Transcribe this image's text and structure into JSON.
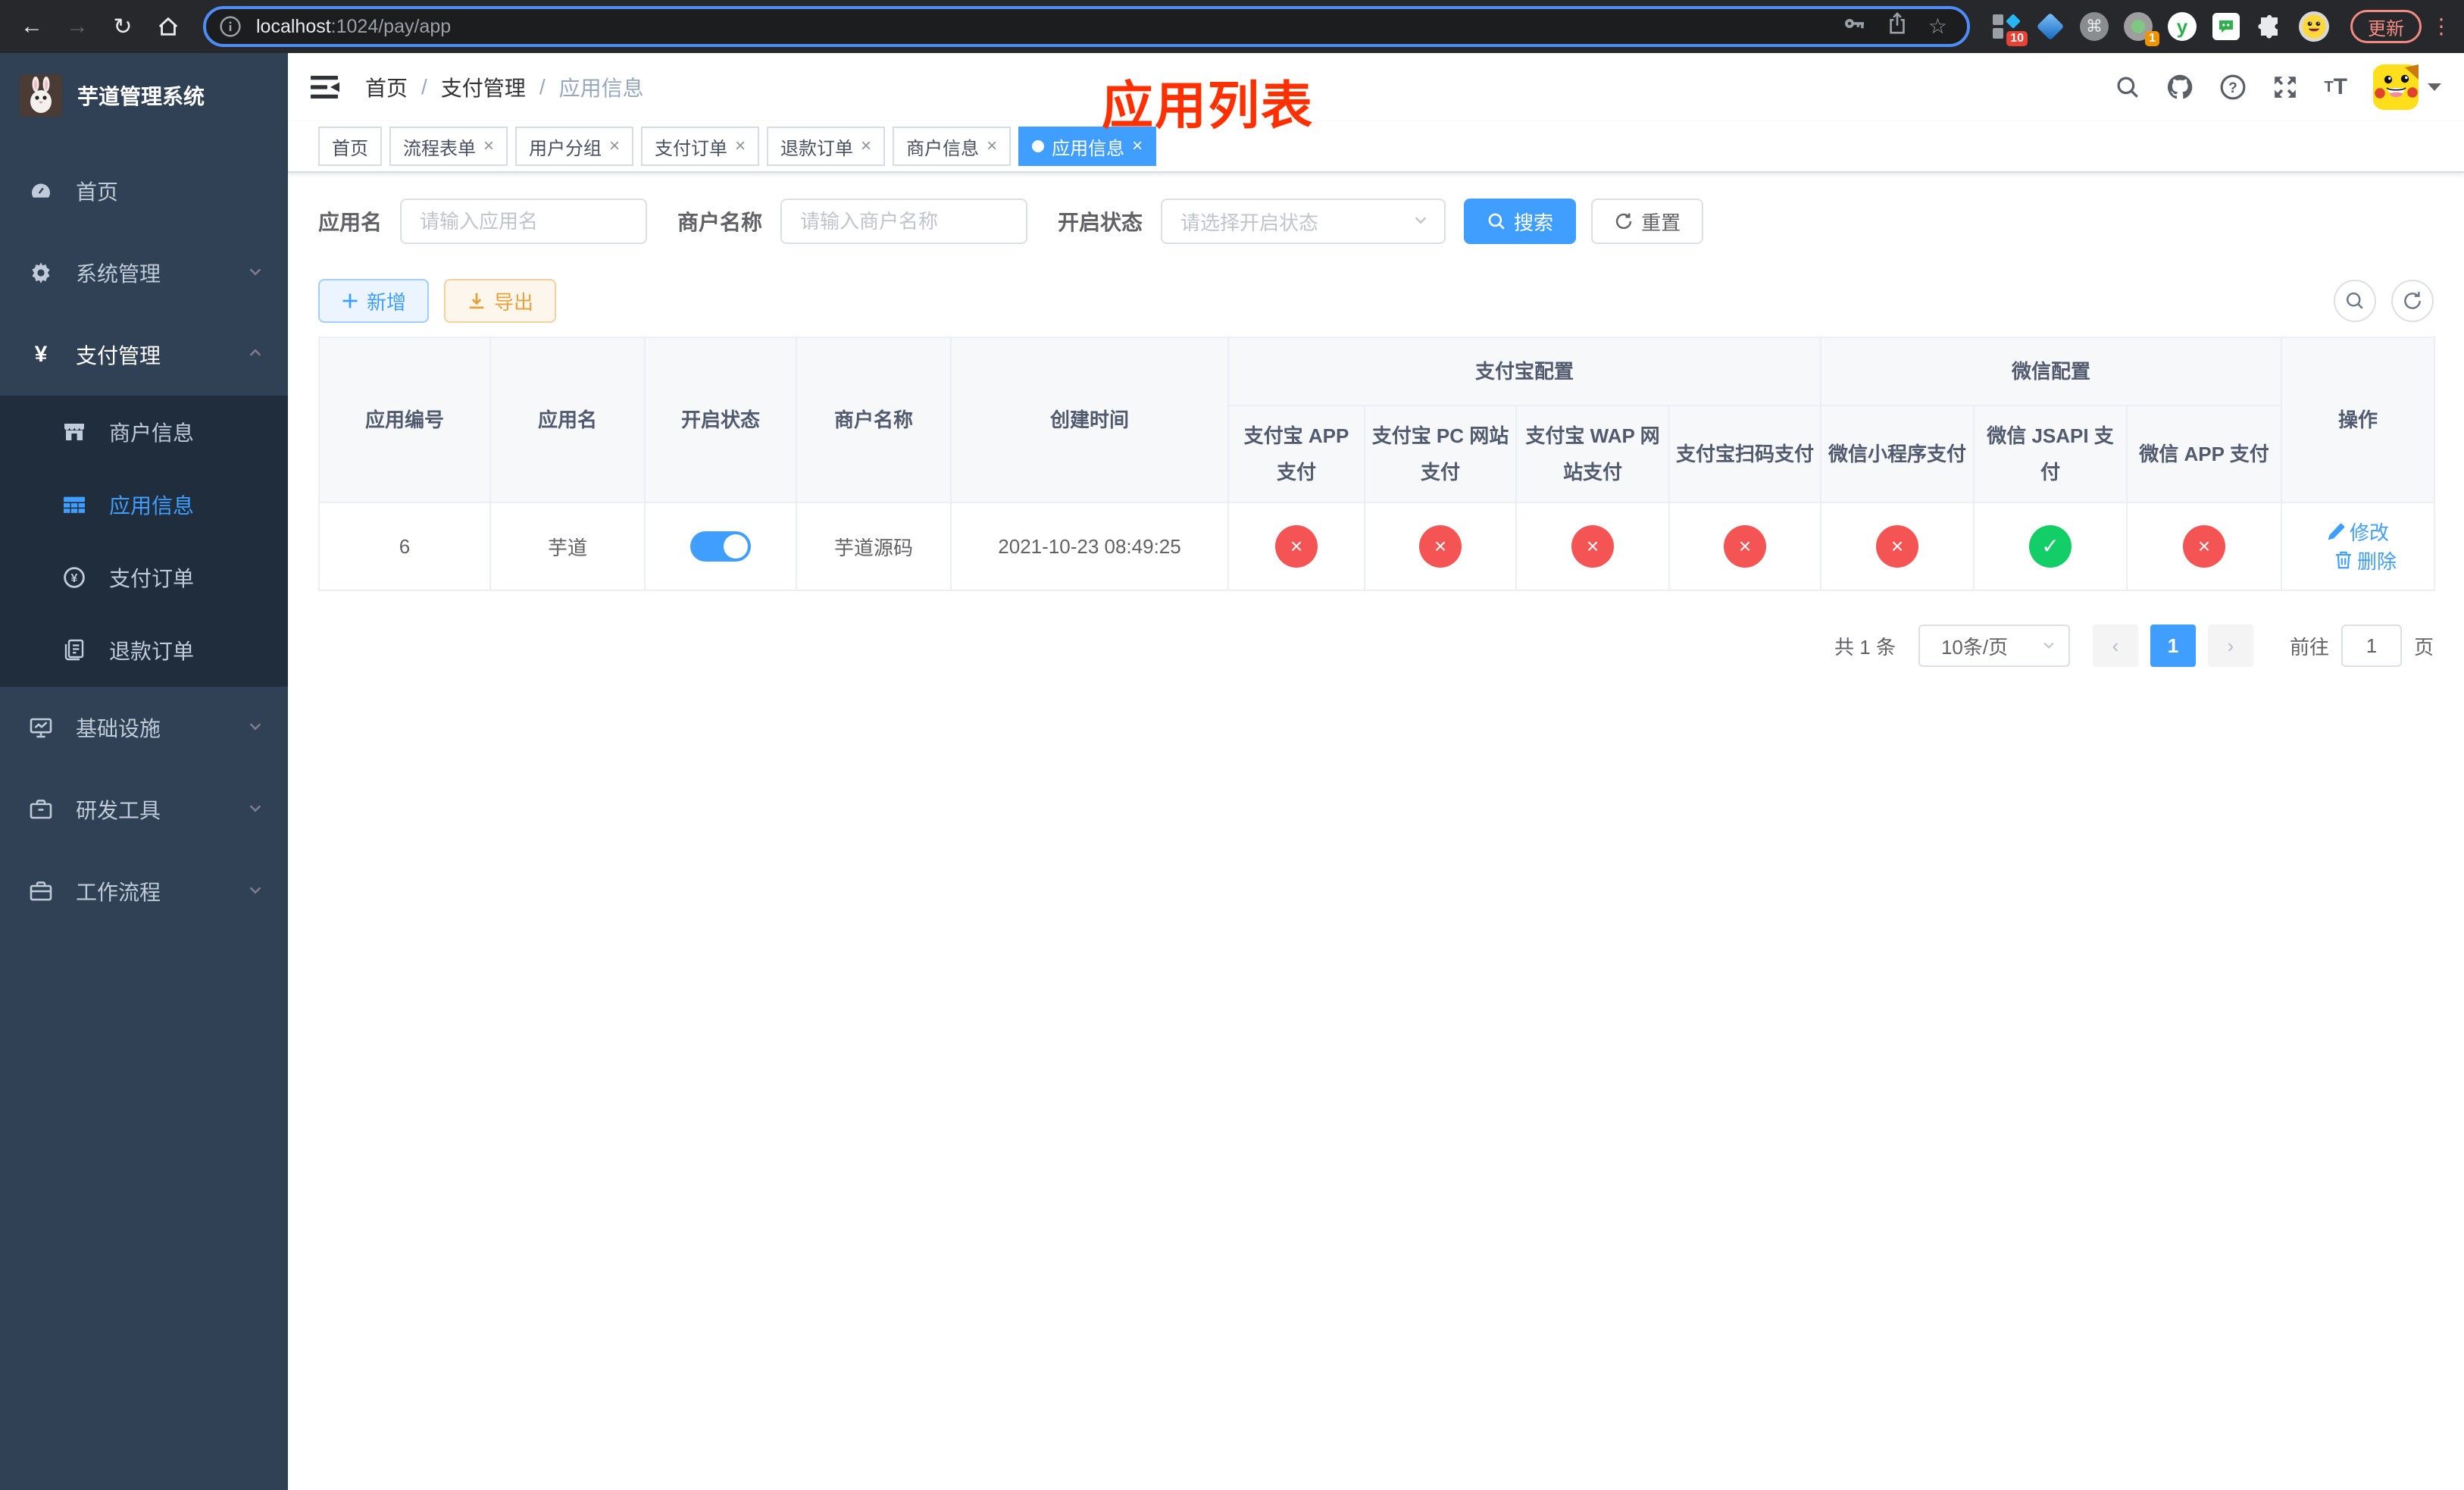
{
  "colors": {
    "primary": "#409eff",
    "success": "#13ce66",
    "danger": "#f45454",
    "stamp": "#ff3000",
    "warning": "#e6a23c",
    "update": "#f28b82"
  },
  "browser": {
    "url_host": "localhost",
    "url_rest": ":1024/pay/app",
    "update_label": "更新",
    "ext_badge_count": "10",
    "ext_badge_one": "1",
    "ext_y_letter": "y",
    "icons": [
      "back-icon",
      "forward-icon",
      "reload-icon",
      "home-icon",
      "info-icon",
      "key-icon",
      "share-icon",
      "star-icon",
      "extensions-puzzle-icon",
      "profile-avatar",
      "menu-kebab-icon"
    ]
  },
  "sidebar": {
    "title": "芋道管理系统",
    "items": [
      {
        "label": "首页",
        "icon": "dashboard-icon"
      },
      {
        "label": "系统管理",
        "icon": "gear-icon"
      },
      {
        "label": "支付管理",
        "icon": "yen-icon"
      },
      {
        "label": "商户信息",
        "icon": "shop-icon"
      },
      {
        "label": "应用信息",
        "icon": "grid-icon"
      },
      {
        "label": "支付订单",
        "icon": "coin-icon"
      },
      {
        "label": "退款订单",
        "icon": "document-icon"
      },
      {
        "label": "基础设施",
        "icon": "monitor-icon"
      },
      {
        "label": "研发工具",
        "icon": "toolbox-icon"
      },
      {
        "label": "工作流程",
        "icon": "briefcase-icon"
      }
    ]
  },
  "header": {
    "breadcrumb": [
      "首页",
      "支付管理",
      "应用信息"
    ],
    "sep": "/",
    "stamp": "应用列表",
    "icons": [
      "search-icon",
      "github-icon",
      "help-icon",
      "fullscreen-icon",
      "font-size-icon",
      "user-avatar",
      "caret-down-icon"
    ]
  },
  "tabs": [
    {
      "label": "首页"
    },
    {
      "label": "流程表单"
    },
    {
      "label": "用户分组"
    },
    {
      "label": "支付订单"
    },
    {
      "label": "退款订单"
    },
    {
      "label": "商户信息"
    },
    {
      "label": "应用信息"
    }
  ],
  "ui": {
    "close_glyph": "×"
  },
  "search": {
    "fields": [
      {
        "label": "应用名",
        "placeholder": "请输入应用名"
      },
      {
        "label": "商户名称",
        "placeholder": "请输入商户名称"
      },
      {
        "label": "开启状态",
        "placeholder": "请选择开启状态"
      }
    ],
    "search_label": "搜索",
    "reset_label": "重置"
  },
  "toolbar": {
    "add_label": "新增",
    "export_label": "导出"
  },
  "table": {
    "columns": [
      "应用编号",
      "应用名",
      "开启状态",
      "商户名称",
      "创建时间"
    ],
    "groups": [
      {
        "label": "支付宝配置",
        "children": [
          "支付宝 APP 支付",
          "支付宝 PC 网站支付",
          "支付宝 WAP 网站支付",
          "支付宝扫码支付"
        ]
      },
      {
        "label": "微信配置",
        "children": [
          "微信小程序支付",
          "微信 JSAPI 支付",
          "微信 APP 支付"
        ]
      }
    ],
    "action_col": "操作",
    "row": {
      "id": "6",
      "name": "芋道",
      "enabled_state": "on",
      "merchant": "芋道源码",
      "created_at": "2021-10-23 08:49:25",
      "configs": [
        {
          "glyph": "×",
          "state": "off"
        },
        {
          "glyph": "×",
          "state": "off"
        },
        {
          "glyph": "×",
          "state": "off"
        },
        {
          "glyph": "×",
          "state": "off"
        },
        {
          "glyph": "×",
          "state": "off"
        },
        {
          "glyph": "✓",
          "state": "on"
        },
        {
          "glyph": "×",
          "state": "off"
        }
      ],
      "edit_label": "修改",
      "delete_label": "删除"
    }
  },
  "pagination": {
    "total": "共 1 条",
    "page_size": "10条/页",
    "prev_glyph": "‹",
    "next_glyph": "›",
    "page": "1",
    "goto_label": "前往",
    "goto_value": "1",
    "page_unit": "页"
  }
}
